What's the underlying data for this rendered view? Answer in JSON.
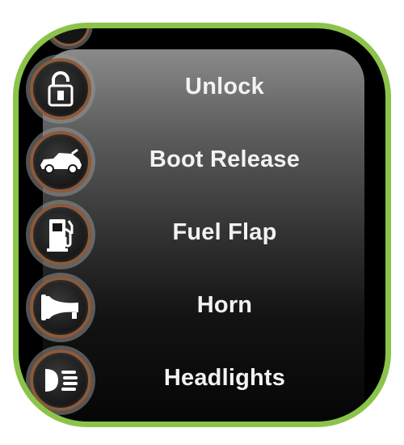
{
  "menu": {
    "items": [
      {
        "label": "Unlock",
        "icon": "unlock-icon"
      },
      {
        "label": "Boot Release",
        "icon": "car-boot-icon"
      },
      {
        "label": "Fuel Flap",
        "icon": "fuel-pump-icon"
      },
      {
        "label": "Horn",
        "icon": "horn-icon"
      },
      {
        "label": "Headlights",
        "icon": "headlights-icon"
      }
    ]
  },
  "colors": {
    "frame_border": "#8cc34a",
    "icon_ring": "#8c5a3a",
    "text": "#f2f2f2"
  }
}
